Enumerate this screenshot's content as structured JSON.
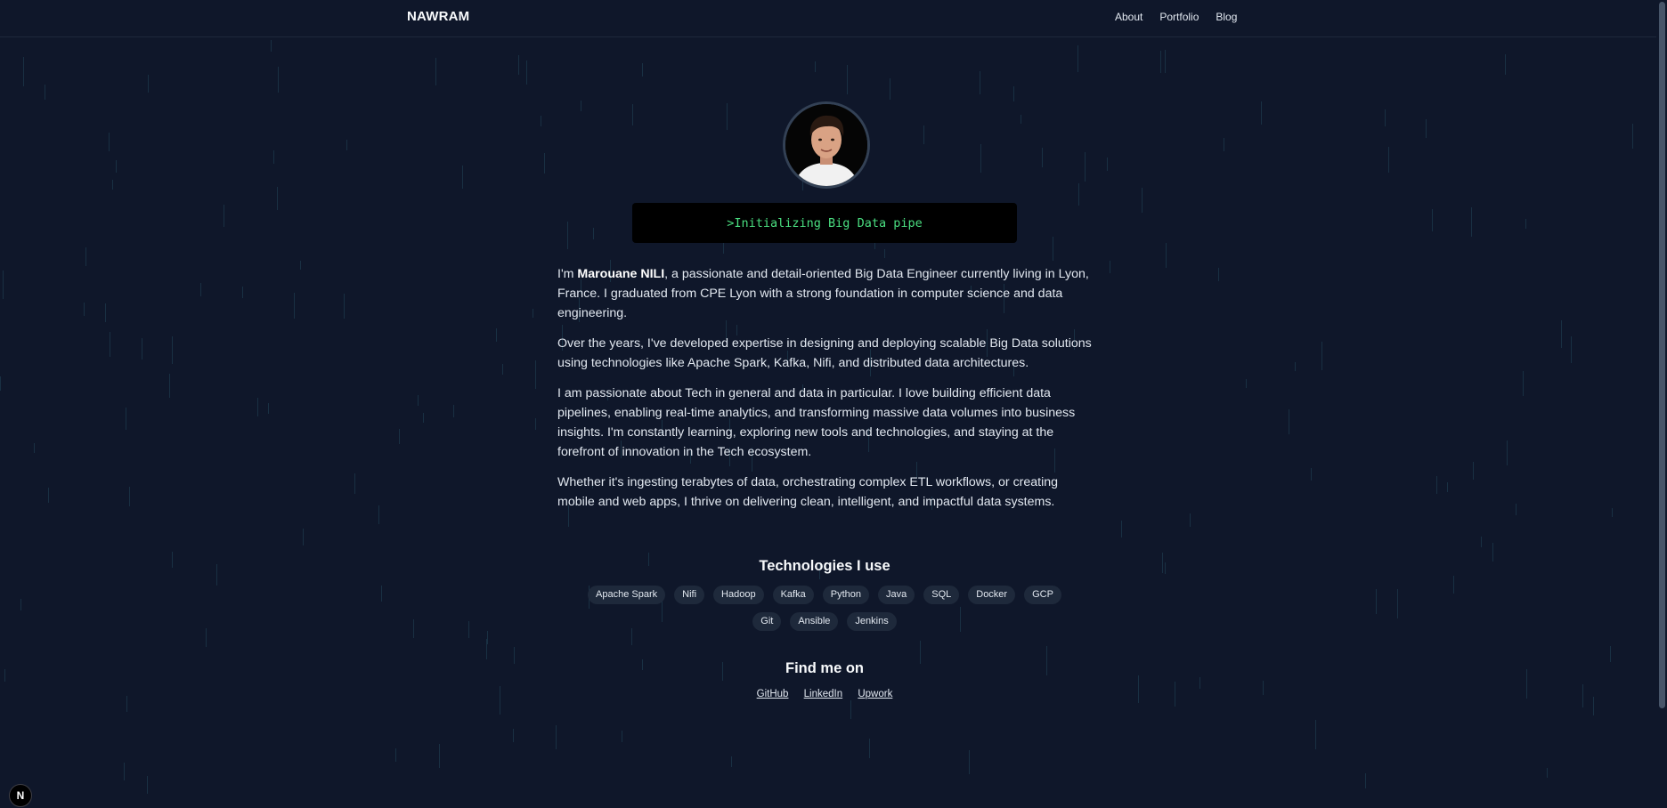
{
  "header": {
    "brand": "NAWRAM",
    "nav": [
      "About",
      "Portfolio",
      "Blog"
    ]
  },
  "profile": {
    "avatar_icon": "profile-photo",
    "terminal_text": ">Initializing Big Data pipe"
  },
  "bio": {
    "intro_prefix": "I'm ",
    "name": "Marouane NILI",
    "intro_suffix": ", a passionate and detail-oriented Big Data Engineer currently living in Lyon, France. I graduated from CPE Lyon with a strong foundation in computer science and data engineering.",
    "p2": "Over the years, I've developed expertise in designing and deploying scalable Big Data solutions using technologies like Apache Spark, Kafka, Nifi, and distributed data architectures.",
    "p3": "I am passionate about Tech in general and data in particular. I love building efficient data pipelines, enabling real-time analytics, and transforming massive data volumes into business insights. I'm constantly learning, exploring new tools and technologies, and staying at the forefront of innovation in the Tech ecosystem.",
    "p4": "Whether it's ingesting terabytes of data, orchestrating complex ETL workflows, or creating mobile and web apps, I thrive on delivering clean, intelligent, and impactful data systems."
  },
  "technologies": {
    "title": "Technologies I use",
    "items": [
      "Apache Spark",
      "Nifi",
      "Hadoop",
      "Kafka",
      "Python",
      "Java",
      "SQL",
      "Docker",
      "GCP",
      "Git",
      "Ansible",
      "Jenkins"
    ]
  },
  "social": {
    "title": "Find me on",
    "links": [
      "GitHub",
      "LinkedIn",
      "Upwork"
    ]
  },
  "dev_badge": {
    "label": "N",
    "icon": "nextjs-icon"
  },
  "colors": {
    "background": "#0f172a",
    "terminal_text": "#4ade80",
    "chip_bg": "#1e293b"
  }
}
